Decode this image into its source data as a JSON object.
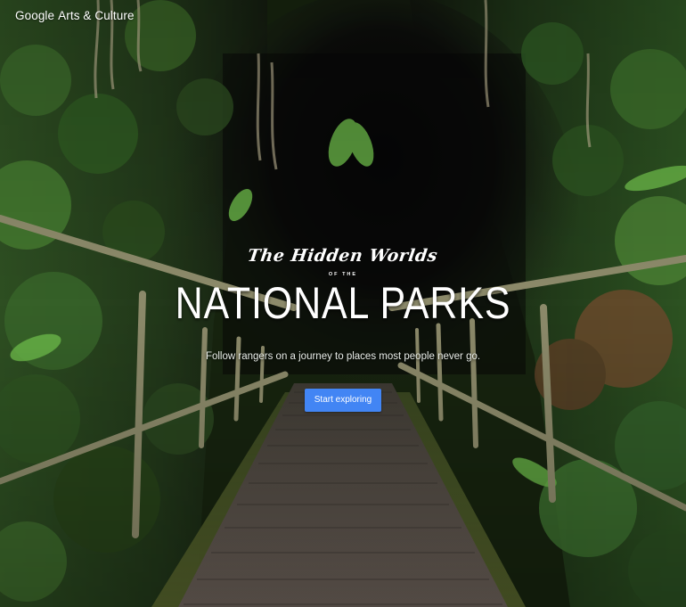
{
  "header": {
    "logo_brand": "Google",
    "logo_product": "Arts & Culture"
  },
  "hero": {
    "script_title": "The Hidden Worlds",
    "connector": "OF THE",
    "title": "NATIONAL PARKS",
    "subtitle": "Follow rangers on a journey to places most people never go.",
    "cta_label": "Start exploring"
  },
  "colors": {
    "accent": "#4285f4",
    "foliage": "#2f5a24",
    "cave": "#0a0a0a"
  }
}
